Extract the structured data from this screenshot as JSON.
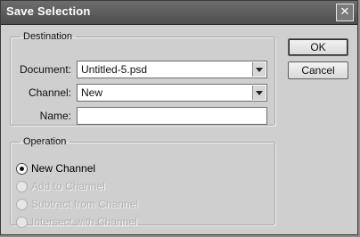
{
  "window": {
    "title": "Save Selection",
    "close_glyph": "✕"
  },
  "buttons": {
    "ok": "OK",
    "cancel": "Cancel"
  },
  "destination": {
    "legend": "Destination",
    "document_label": "Document:",
    "document_value": "Untitled-5.psd",
    "channel_label": "Channel:",
    "channel_value": "New",
    "name_label": "Name:",
    "name_value": ""
  },
  "operation": {
    "legend": "Operation",
    "options": [
      {
        "label": "New Channel",
        "selected": true,
        "enabled": true
      },
      {
        "label": "Add to Channel",
        "selected": false,
        "enabled": false
      },
      {
        "label": "Subtract from Channel",
        "selected": false,
        "enabled": false
      },
      {
        "label": "Intersect with Channel",
        "selected": false,
        "enabled": false
      }
    ]
  },
  "icons": {
    "close": "close-icon",
    "dropdown": "chevron-down-icon"
  },
  "colors": {
    "titlebar": "#5a5a5a",
    "dialog_bg": "#cfcfcf"
  }
}
